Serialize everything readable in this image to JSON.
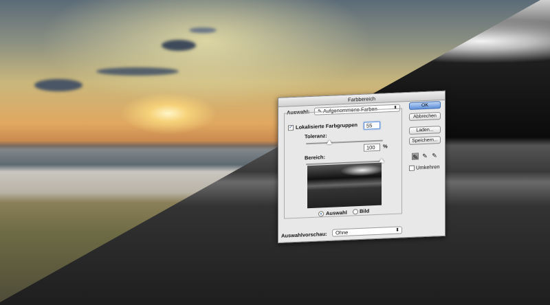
{
  "dialog": {
    "title": "Farbbereich",
    "auswahl_label": "Auswahl:",
    "auswahl_value": "Aufgenommene Farben",
    "localized_label": "Lokalisierte Farbgruppen",
    "localized_checked": true,
    "toleranz_label": "Toleranz:",
    "toleranz_value": "55",
    "toleranz_level": 55,
    "bereich_label": "Bereich:",
    "bereich_value": "100",
    "bereich_unit": "%",
    "bereich_level": 100,
    "radio_auswahl": "Auswahl",
    "radio_bild": "Bild",
    "radio_selected": "Auswahl",
    "vorschau_label": "Auswahlvorschau:",
    "vorschau_value": "Ohne",
    "buttons": {
      "ok": "OK",
      "cancel": "Abbrechen",
      "load": "Laden...",
      "save": "Speichern..."
    },
    "invert_label": "Umkehren",
    "invert_checked": false,
    "eyedroppers": [
      "eyedropper-icon",
      "eyedropper-plus-icon",
      "eyedropper-minus-icon"
    ]
  }
}
